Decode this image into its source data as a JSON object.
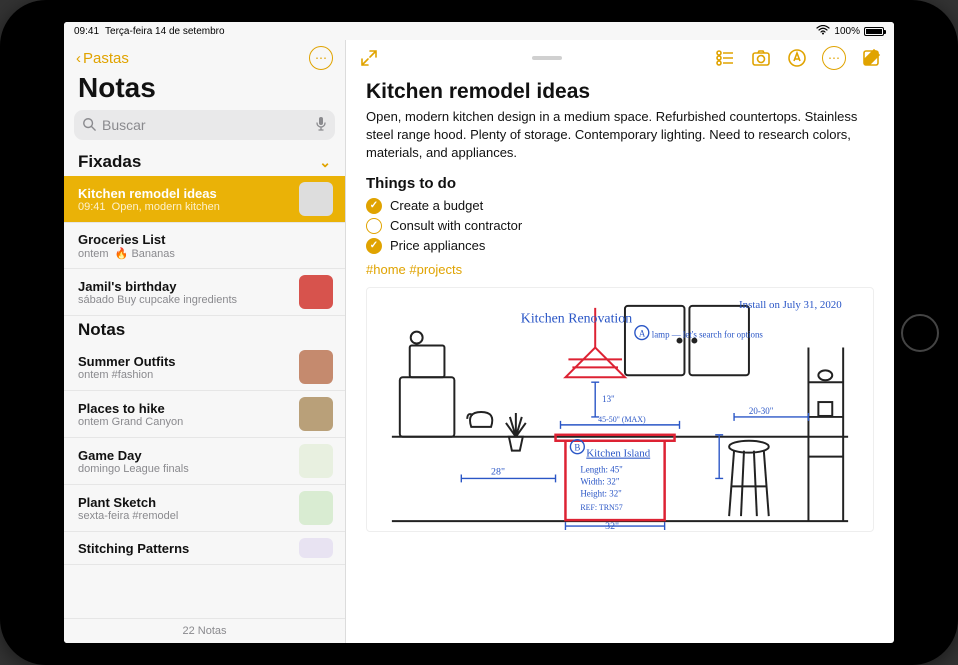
{
  "statusbar": {
    "time": "09:41",
    "date": "Terça-feira 14 de setembro",
    "wifi": "􀙇",
    "battery_pct": "100%"
  },
  "sidebar": {
    "back_label": "Pastas",
    "title": "Notas",
    "search_placeholder": "Buscar",
    "sections": {
      "pinned": {
        "label": "Fixadas"
      },
      "notes": {
        "label": "Notas"
      }
    },
    "pinned": [
      {
        "title": "Kitchen remodel ideas",
        "time": "09:41",
        "preview": "Open, modern kitchen"
      },
      {
        "title": "Groceries List",
        "time": "ontem",
        "preview": "🔥  Bananas"
      },
      {
        "title": "Jamil's birthday",
        "time": "sábado",
        "preview": "Buy cupcake ingredients"
      }
    ],
    "notes": [
      {
        "title": "Summer Outfits",
        "time": "ontem",
        "preview": "#fashion"
      },
      {
        "title": "Places to hike",
        "time": "ontem",
        "preview": "Grand Canyon"
      },
      {
        "title": "Game Day",
        "time": "domingo",
        "preview": "League finals"
      },
      {
        "title": "Plant Sketch",
        "time": "sexta-feira",
        "preview": "#remodel"
      },
      {
        "title": "Stitching Patterns",
        "time": "",
        "preview": ""
      }
    ],
    "footer": "22 Notas"
  },
  "note": {
    "title": "Kitchen remodel ideas",
    "body": "Open, modern kitchen design in a medium space. Refurbished countertops. Stainless steel range hood. Plenty of storage. Contemporary lighting. Need to research colors, materials, and appliances.",
    "subheading": "Things to do",
    "todos": [
      {
        "label": "Create a budget",
        "done": true
      },
      {
        "label": "Consult with contractor",
        "done": false
      },
      {
        "label": "Price appliances",
        "done": true
      }
    ],
    "tags": "#home #projects",
    "sketch": {
      "script_title": "Kitchen Renovation",
      "install_date": "Install on July 31, 2020",
      "island_label": "Kitchen Island",
      "island_dims": [
        "Length: 45\"",
        "Width: 32\"",
        "Height: 32\""
      ],
      "ref": "REF: TRN57",
      "dim_left": "28\"",
      "dim_bottom": "32\"",
      "dim_center": "45-50\" (MAX)",
      "dim_height": "13\"",
      "dim_right": "20-30\"",
      "lamp_note": "lamp — let's search for options",
      "circle_a": "A",
      "circle_b": "B"
    }
  },
  "thumbs": {
    "t0": "#f3f3f0",
    "t1": "#e9d9b7",
    "t2": "#d7534d",
    "t3": "#c58a6e",
    "t4": "#b9a079",
    "t5": "#e8f0e0",
    "t6": "#d9ecd2",
    "t7": "#e8e3f2"
  }
}
